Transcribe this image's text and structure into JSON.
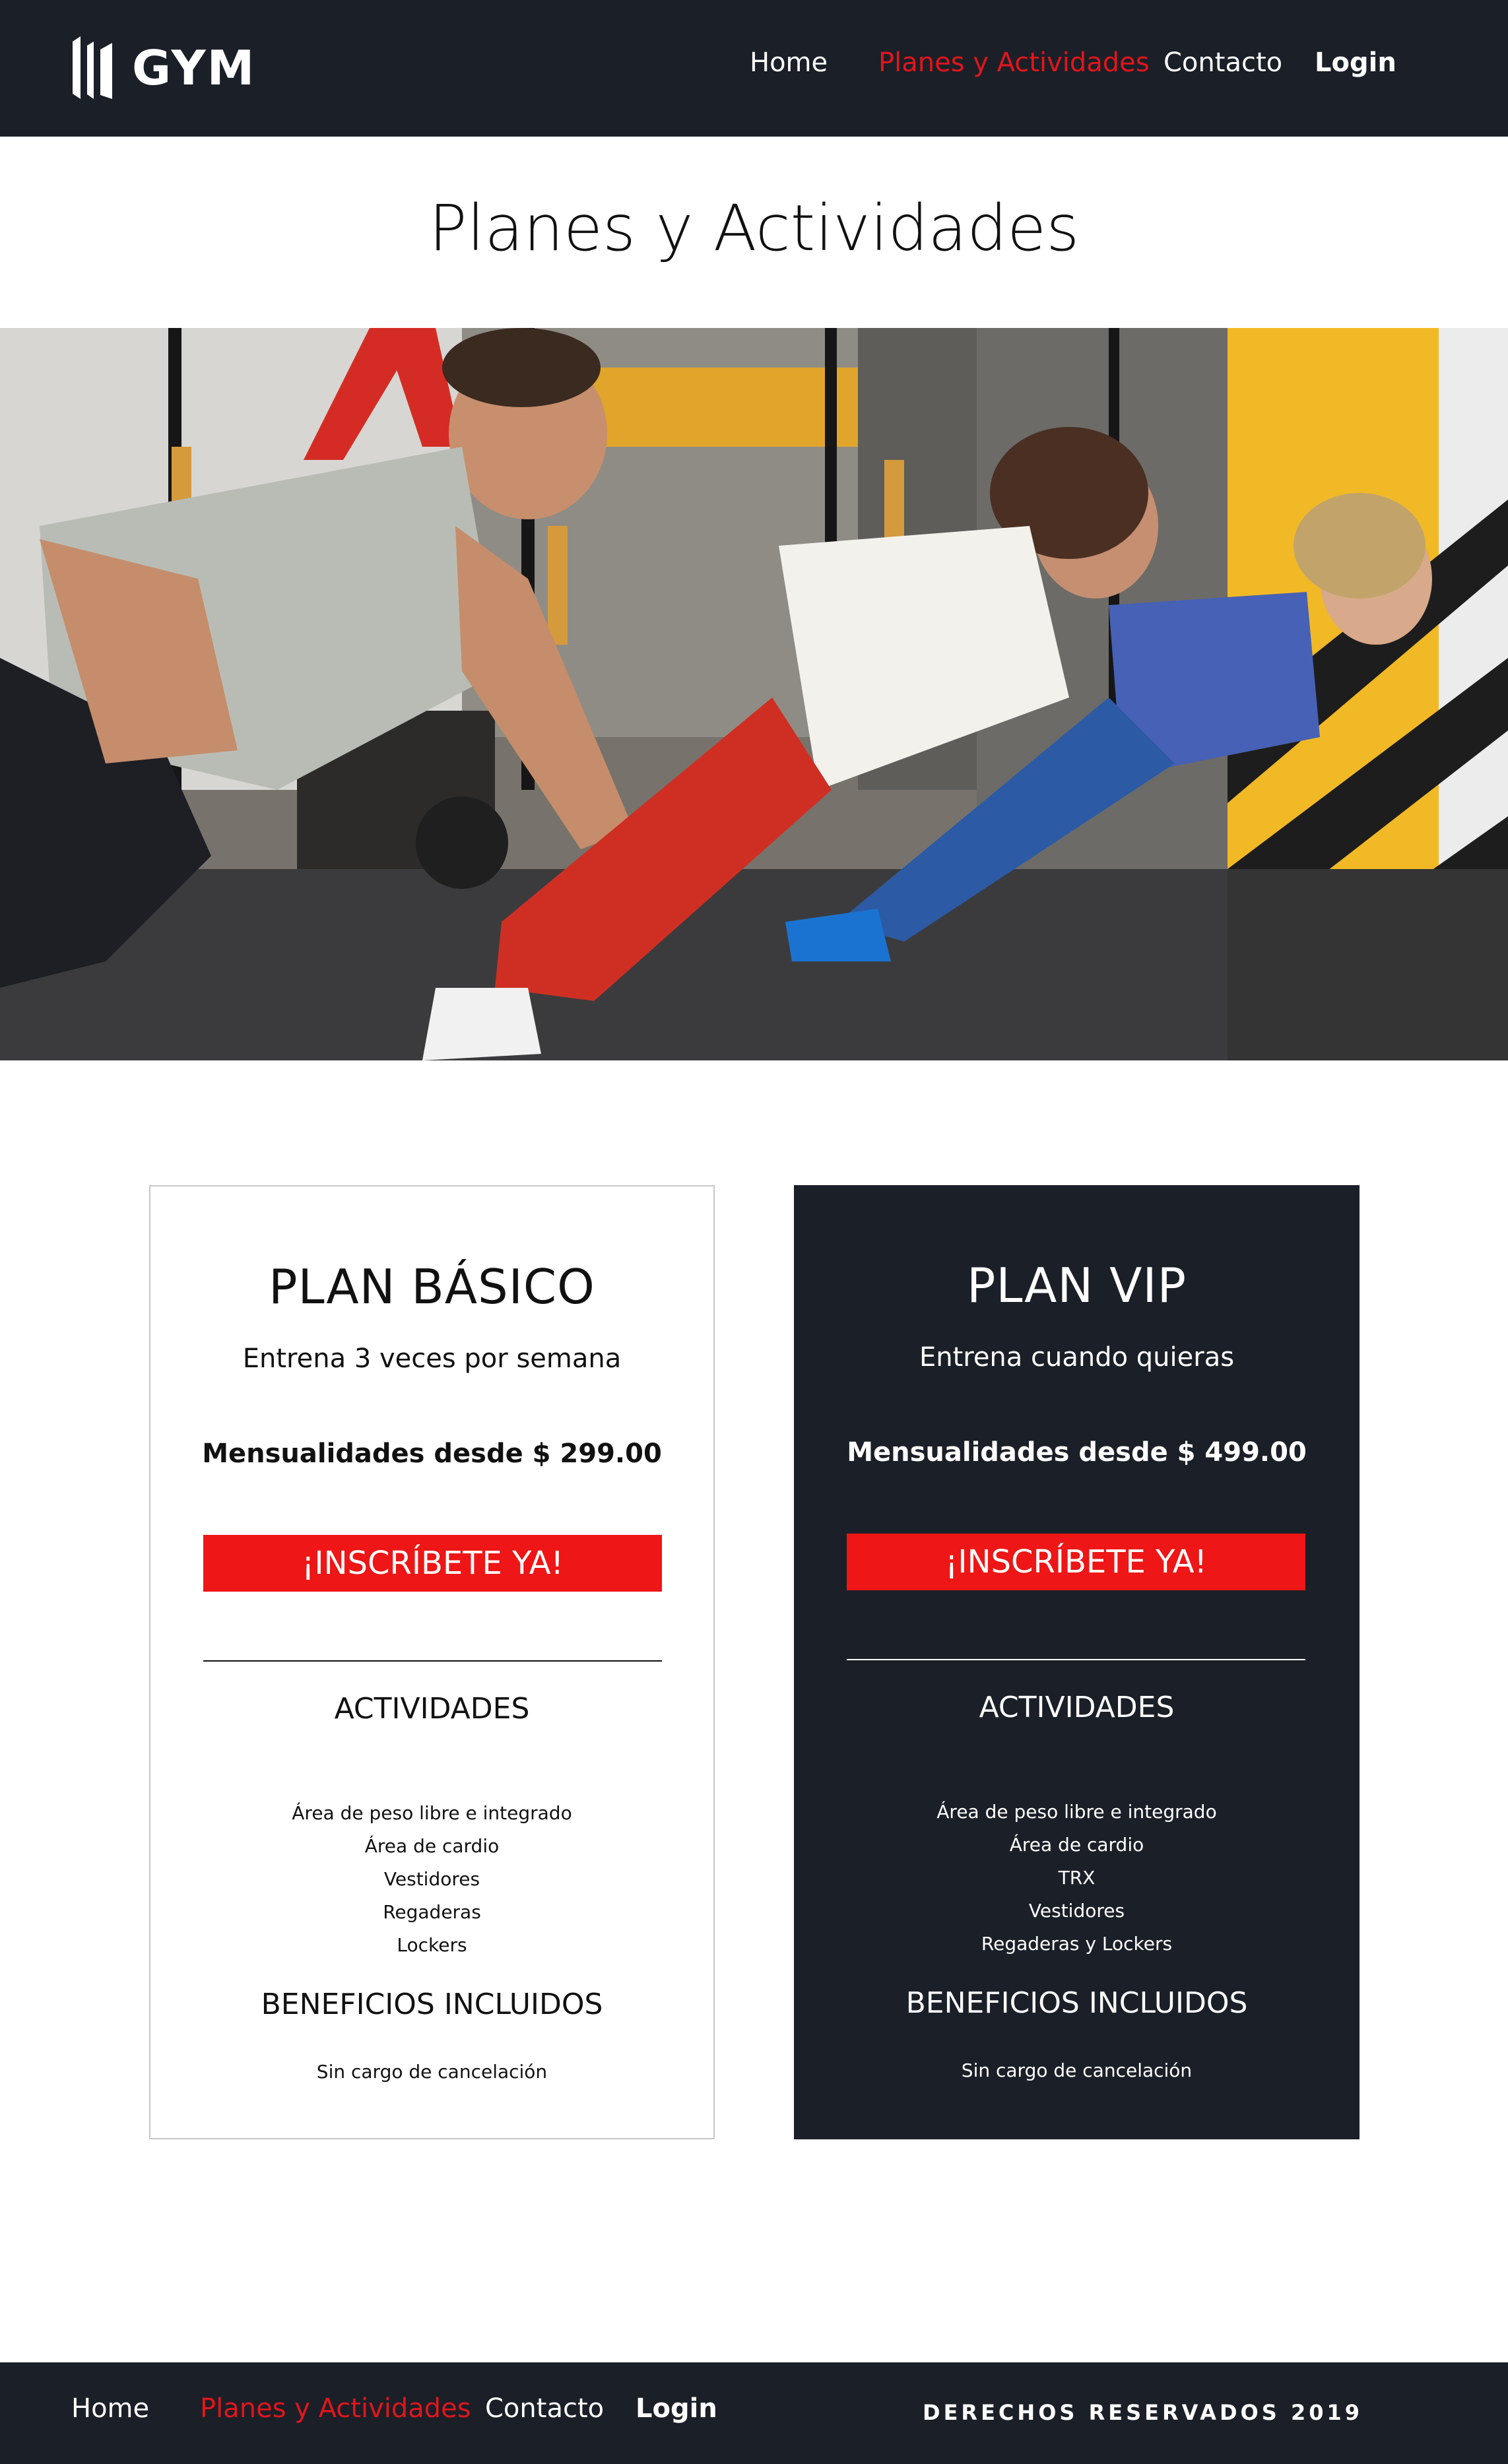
{
  "header": {
    "logo_text": "GYM",
    "nav": {
      "home": "Home",
      "plans": "Planes y Actividades",
      "contact": "Contacto",
      "login": "Login"
    }
  },
  "page": {
    "title": "Planes y Actividades"
  },
  "plans": {
    "basic": {
      "title": "PLAN BÁSICO",
      "subtitle": "Entrena 3 veces por semana",
      "price": "Mensualidades desde $ 299.00",
      "cta": "¡INSCRÍBETE YA!",
      "activities_title": "ACTIVIDADES",
      "activities": [
        "Área de peso libre e integrado",
        "Área de cardio",
        "Vestidores",
        "Regaderas",
        "Lockers"
      ],
      "benefits_title": "BENEFICIOS INCLUIDOS",
      "benefit": "Sin cargo de cancelación"
    },
    "vip": {
      "title": "PLAN VIP",
      "subtitle": "Entrena cuando quieras",
      "price": "Mensualidades desde $ 499.00",
      "cta": "¡INSCRÍBETE YA!",
      "activities_title": "ACTIVIDADES",
      "activities": [
        "Área de peso libre e integrado",
        "Área de cardio",
        "TRX",
        "Vestidores",
        "Regaderas y Lockers"
      ],
      "benefits_title": "BENEFICIOS INCLUIDOS",
      "benefit": "Sin cargo de cancelación"
    }
  },
  "footer": {
    "nav": {
      "home": "Home",
      "plans": "Planes y Actividades",
      "contact": "Contacto",
      "login": "Login"
    },
    "copyright": "DERECHOS RESERVADOS 2019"
  },
  "colors": {
    "dark": "#1b1f27",
    "accent": "#ee1616",
    "nav_active": "#e0161c"
  },
  "icons": {
    "logo": "gym-logo-icon"
  }
}
